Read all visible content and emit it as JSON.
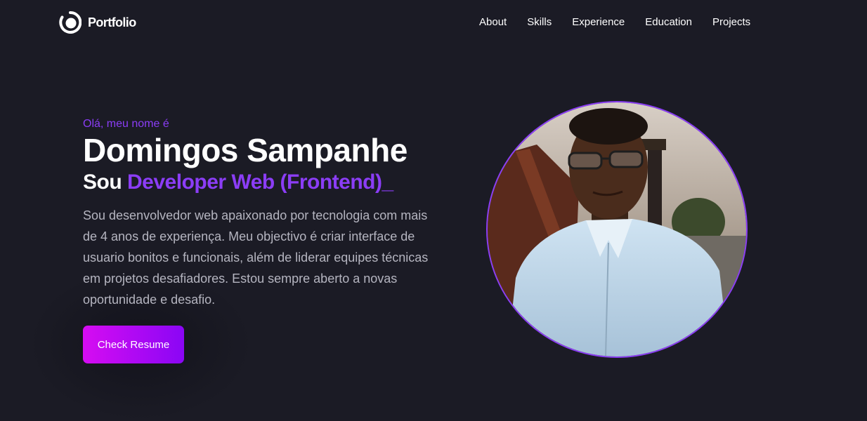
{
  "nav": {
    "brand": "Portfolio",
    "brand_icon": "portfolio-logo-icon",
    "items": [
      {
        "label": "About"
      },
      {
        "label": "Skills"
      },
      {
        "label": "Experience"
      },
      {
        "label": "Education"
      },
      {
        "label": "Projects"
      }
    ]
  },
  "hero": {
    "greeting": "Olá, meu nome é",
    "name": "Domingos Sampanhe",
    "role_prefix": "Sou",
    "role_highlight": "Developer Web (Frontend)_",
    "bio": "Sou desenvolvedor web apaixonado por tecnologia com mais de 4 anos de experiença. Meu objectivo é criar interface de usuario bonitos e funcionais, além de liderar equipes técnicas em projetos desafiadores. Estou sempre aberto a novas oportunidade e desafio.",
    "cta_label": "Check Resume"
  },
  "colors": {
    "background": "#1b1b25",
    "accent": "#8b3df6",
    "button_start": "#d60cf2",
    "button_end": "#8a06f5"
  }
}
